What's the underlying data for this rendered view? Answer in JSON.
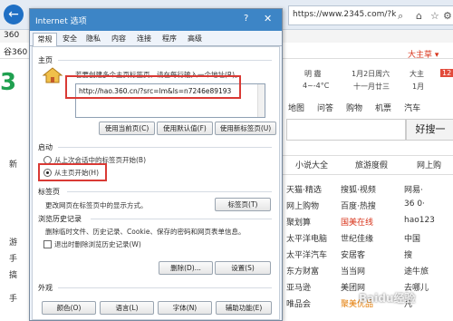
{
  "browser": {
    "address_right": "https://www.2345.com/?k",
    "left_partial": "360",
    "row2_partial": "谷360"
  },
  "page": {
    "brand_text": "3",
    "weather": [
      "明 霾",
      "4~-4°C",
      "1月2日周六",
      "十一月廿三",
      "大主",
      "1月",
      "12"
    ],
    "user_link": "大主草 ▾",
    "nav_links": [
      "地图",
      "问答",
      "购物",
      "机票",
      "汽车"
    ],
    "search_button": "好搜一",
    "top_tabs": [
      "小说大全",
      "旅游度假",
      "网上购"
    ],
    "sites": [
      [
        "天猫·精选",
        "搜狐·视频",
        "网易·"
      ],
      [
        "网上购物",
        "百度·热搜",
        "36 0·"
      ],
      [
        "聚划算",
        "国美在线",
        "hao123"
      ],
      [
        "太平洋电脑",
        "世纪佳缘",
        "中国"
      ],
      [
        "太平洋汽车",
        "安居客",
        "搜"
      ],
      [
        "东方财富",
        "当当网",
        "途牛旅"
      ],
      [
        "亚马逊",
        "美团网",
        "去哪儿"
      ],
      [
        "唯品会",
        "聚美优品",
        "凡"
      ]
    ],
    "left_items": [
      "新",
      "游",
      "手",
      "搞",
      "手"
    ]
  },
  "dialog": {
    "title": "Internet 选项",
    "help": "?",
    "close": "✕",
    "tabs": [
      "常规",
      "安全",
      "隐私",
      "内容",
      "连接",
      "程序",
      "高级"
    ],
    "home": {
      "section": "主页",
      "desc": "若要创建多个主页标签页，请在每行输入一个地址(R)。",
      "url": "http://hao.360.cn/?src=lm&ls=n7246e89193",
      "buttons": [
        "使用当前页(C)",
        "使用默认值(F)",
        "使用新标签页(U)"
      ]
    },
    "startup": {
      "section": "启动",
      "options": [
        "从上次会话中的标签页开始(B)",
        "从主页开始(H)"
      ]
    },
    "tabs_section": {
      "section": "标签页",
      "desc": "更改网页在标签页中的显示方式。",
      "button": "标签页(T)"
    },
    "history": {
      "section": "浏览历史记录",
      "desc": "删除临时文件、历史记录、Cookie、保存的密码和网页表单信息。",
      "checkbox": "退出时删除浏览历史记录(W)",
      "buttons": [
        "删除(D)...",
        "设置(S)"
      ]
    },
    "appearance": {
      "section": "外观",
      "buttons": [
        "颜色(O)",
        "语言(L)",
        "字体(N)",
        "辅助功能(E)"
      ]
    }
  },
  "watermark": "Baidu经验"
}
